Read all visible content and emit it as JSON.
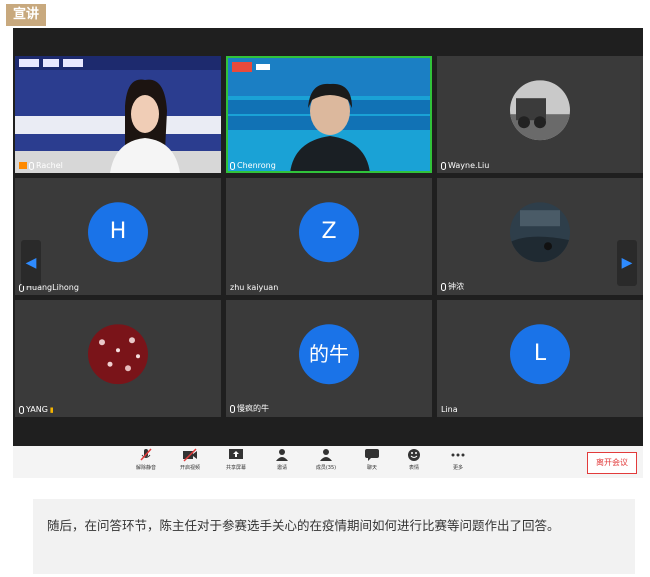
{
  "section_tag": "宣讲",
  "participants": [
    {
      "name": "Rachel",
      "kind": "video"
    },
    {
      "name": "Chenrong",
      "kind": "video",
      "active": true
    },
    {
      "name": "Wayne.Liu",
      "kind": "photo"
    },
    {
      "name": "HuangLihong",
      "kind": "avatar",
      "initial": "H"
    },
    {
      "name": "zhu kaiyuan",
      "kind": "avatar",
      "initial": "Z"
    },
    {
      "name": "钟浓",
      "kind": "photo"
    },
    {
      "name": "YANG",
      "kind": "photo"
    },
    {
      "name": "慢疯的牛",
      "kind": "avatar",
      "initial": "的牛"
    },
    {
      "name": "Lina",
      "kind": "avatar",
      "initial": "L"
    }
  ],
  "banner": {
    "title_line1": "第十二届中国深圳创新创业大赛港澳高校预选赛区",
    "title_line2": "暨第二届深圳港澳大学生创新创业大赛",
    "venue": "香港城市大学"
  },
  "toolbar": {
    "unmute": "解除静音",
    "start_video": "开启视频",
    "share_screen": "共享屏幕",
    "invite": "邀请",
    "members": "成员(35)",
    "chat": "聊天",
    "reactions": "表情",
    "more": "更多",
    "leave": "离开会议"
  },
  "caption": "随后，在问答环节，陈主任对于参赛选手关心的在疫情期间如何进行比赛等问题作出了回答。"
}
